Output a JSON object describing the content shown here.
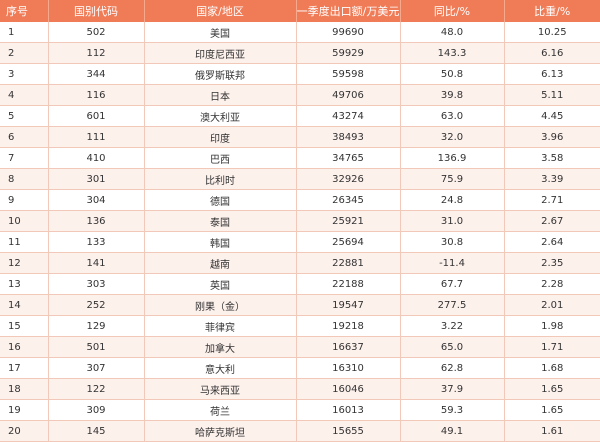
{
  "header": {
    "col_index": "序号",
    "col_code": "国别代码",
    "col_country": "国家/地区",
    "col_export": "一季度出口额/万美元",
    "col_yoy": "同比/%",
    "col_share": "比重/%"
  },
  "rows": [
    {
      "index": "1",
      "code": "502",
      "country": "美国",
      "export": "99690",
      "yoy": "48.0",
      "share": "10.25"
    },
    {
      "index": "2",
      "code": "112",
      "country": "印度尼西亚",
      "export": "59929",
      "yoy": "143.3",
      "share": "6.16"
    },
    {
      "index": "3",
      "code": "344",
      "country": "俄罗斯联邦",
      "export": "59598",
      "yoy": "50.8",
      "share": "6.13"
    },
    {
      "index": "4",
      "code": "116",
      "country": "日本",
      "export": "49706",
      "yoy": "39.8",
      "share": "5.11"
    },
    {
      "index": "5",
      "code": "601",
      "country": "澳大利亚",
      "export": "43274",
      "yoy": "63.0",
      "share": "4.45"
    },
    {
      "index": "6",
      "code": "111",
      "country": "印度",
      "export": "38493",
      "yoy": "32.0",
      "share": "3.96"
    },
    {
      "index": "7",
      "code": "410",
      "country": "巴西",
      "export": "34765",
      "yoy": "136.9",
      "share": "3.58"
    },
    {
      "index": "8",
      "code": "301",
      "country": "比利时",
      "export": "32926",
      "yoy": "75.9",
      "share": "3.39"
    },
    {
      "index": "9",
      "code": "304",
      "country": "德国",
      "export": "26345",
      "yoy": "24.8",
      "share": "2.71"
    },
    {
      "index": "10",
      "code": "136",
      "country": "泰国",
      "export": "25921",
      "yoy": "31.0",
      "share": "2.67"
    },
    {
      "index": "11",
      "code": "133",
      "country": "韩国",
      "export": "25694",
      "yoy": "30.8",
      "share": "2.64"
    },
    {
      "index": "12",
      "code": "141",
      "country": "越南",
      "export": "22881",
      "yoy": "-11.4",
      "share": "2.35"
    },
    {
      "index": "13",
      "code": "303",
      "country": "英国",
      "export": "22188",
      "yoy": "67.7",
      "share": "2.28"
    },
    {
      "index": "14",
      "code": "252",
      "country": "刚果（金）",
      "export": "19547",
      "yoy": "277.5",
      "share": "2.01"
    },
    {
      "index": "15",
      "code": "129",
      "country": "菲律宾",
      "export": "19218",
      "yoy": "3.22",
      "share": "1.98"
    },
    {
      "index": "16",
      "code": "501",
      "country": "加拿大",
      "export": "16637",
      "yoy": "65.0",
      "share": "1.71"
    },
    {
      "index": "17",
      "code": "307",
      "country": "意大利",
      "export": "16310",
      "yoy": "62.8",
      "share": "1.68"
    },
    {
      "index": "18",
      "code": "122",
      "country": "马来西亚",
      "export": "16046",
      "yoy": "37.9",
      "share": "1.65"
    },
    {
      "index": "19",
      "code": "309",
      "country": "荷兰",
      "export": "16013",
      "yoy": "59.3",
      "share": "1.65"
    },
    {
      "index": "20",
      "code": "145",
      "country": "哈萨克斯坦",
      "export": "15655",
      "yoy": "49.1",
      "share": "1.61"
    }
  ]
}
